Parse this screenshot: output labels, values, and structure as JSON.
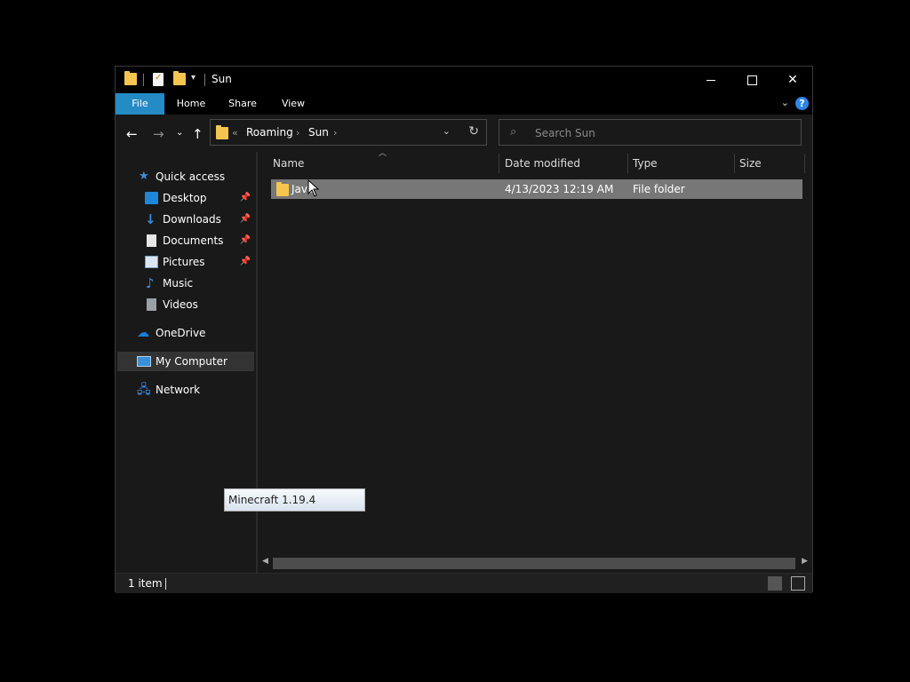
{
  "window": {
    "title": "Sun",
    "controls": {
      "minimize": "minimize-icon",
      "maximize": "maximize-icon",
      "close": "✕"
    }
  },
  "ribbon": {
    "tabs": [
      "File",
      "Home",
      "Share",
      "View"
    ],
    "help": "?"
  },
  "nav": {
    "breadcrumb": [
      "Roaming",
      "Sun"
    ],
    "overflow": "«",
    "separator": "›",
    "search_placeholder": "Search Sun"
  },
  "sidebar": {
    "quick_access": "Quick access",
    "items": [
      {
        "label": "Desktop",
        "icon": "desktop-icon",
        "pinned": true
      },
      {
        "label": "Downloads",
        "icon": "downloads-icon",
        "pinned": true
      },
      {
        "label": "Documents",
        "icon": "documents-icon",
        "pinned": true
      },
      {
        "label": "Pictures",
        "icon": "pictures-icon",
        "pinned": true
      },
      {
        "label": "Music",
        "icon": "music-icon",
        "pinned": false
      },
      {
        "label": "Videos",
        "icon": "videos-icon",
        "pinned": false
      }
    ],
    "onedrive": "OneDrive",
    "my_computer": "My Computer",
    "network": "Network"
  },
  "columns": [
    "Name",
    "Date modified",
    "Type",
    "Size"
  ],
  "files": [
    {
      "name": "Java",
      "date_modified": "4/13/2023 12:19 AM",
      "type": "File folder",
      "size": ""
    }
  ],
  "status": {
    "item_count": "1 item"
  },
  "tooltip": "Minecraft 1.19.4",
  "colors": {
    "accent": "#248bc5",
    "selected_row": "#777777",
    "background": "#191919"
  }
}
